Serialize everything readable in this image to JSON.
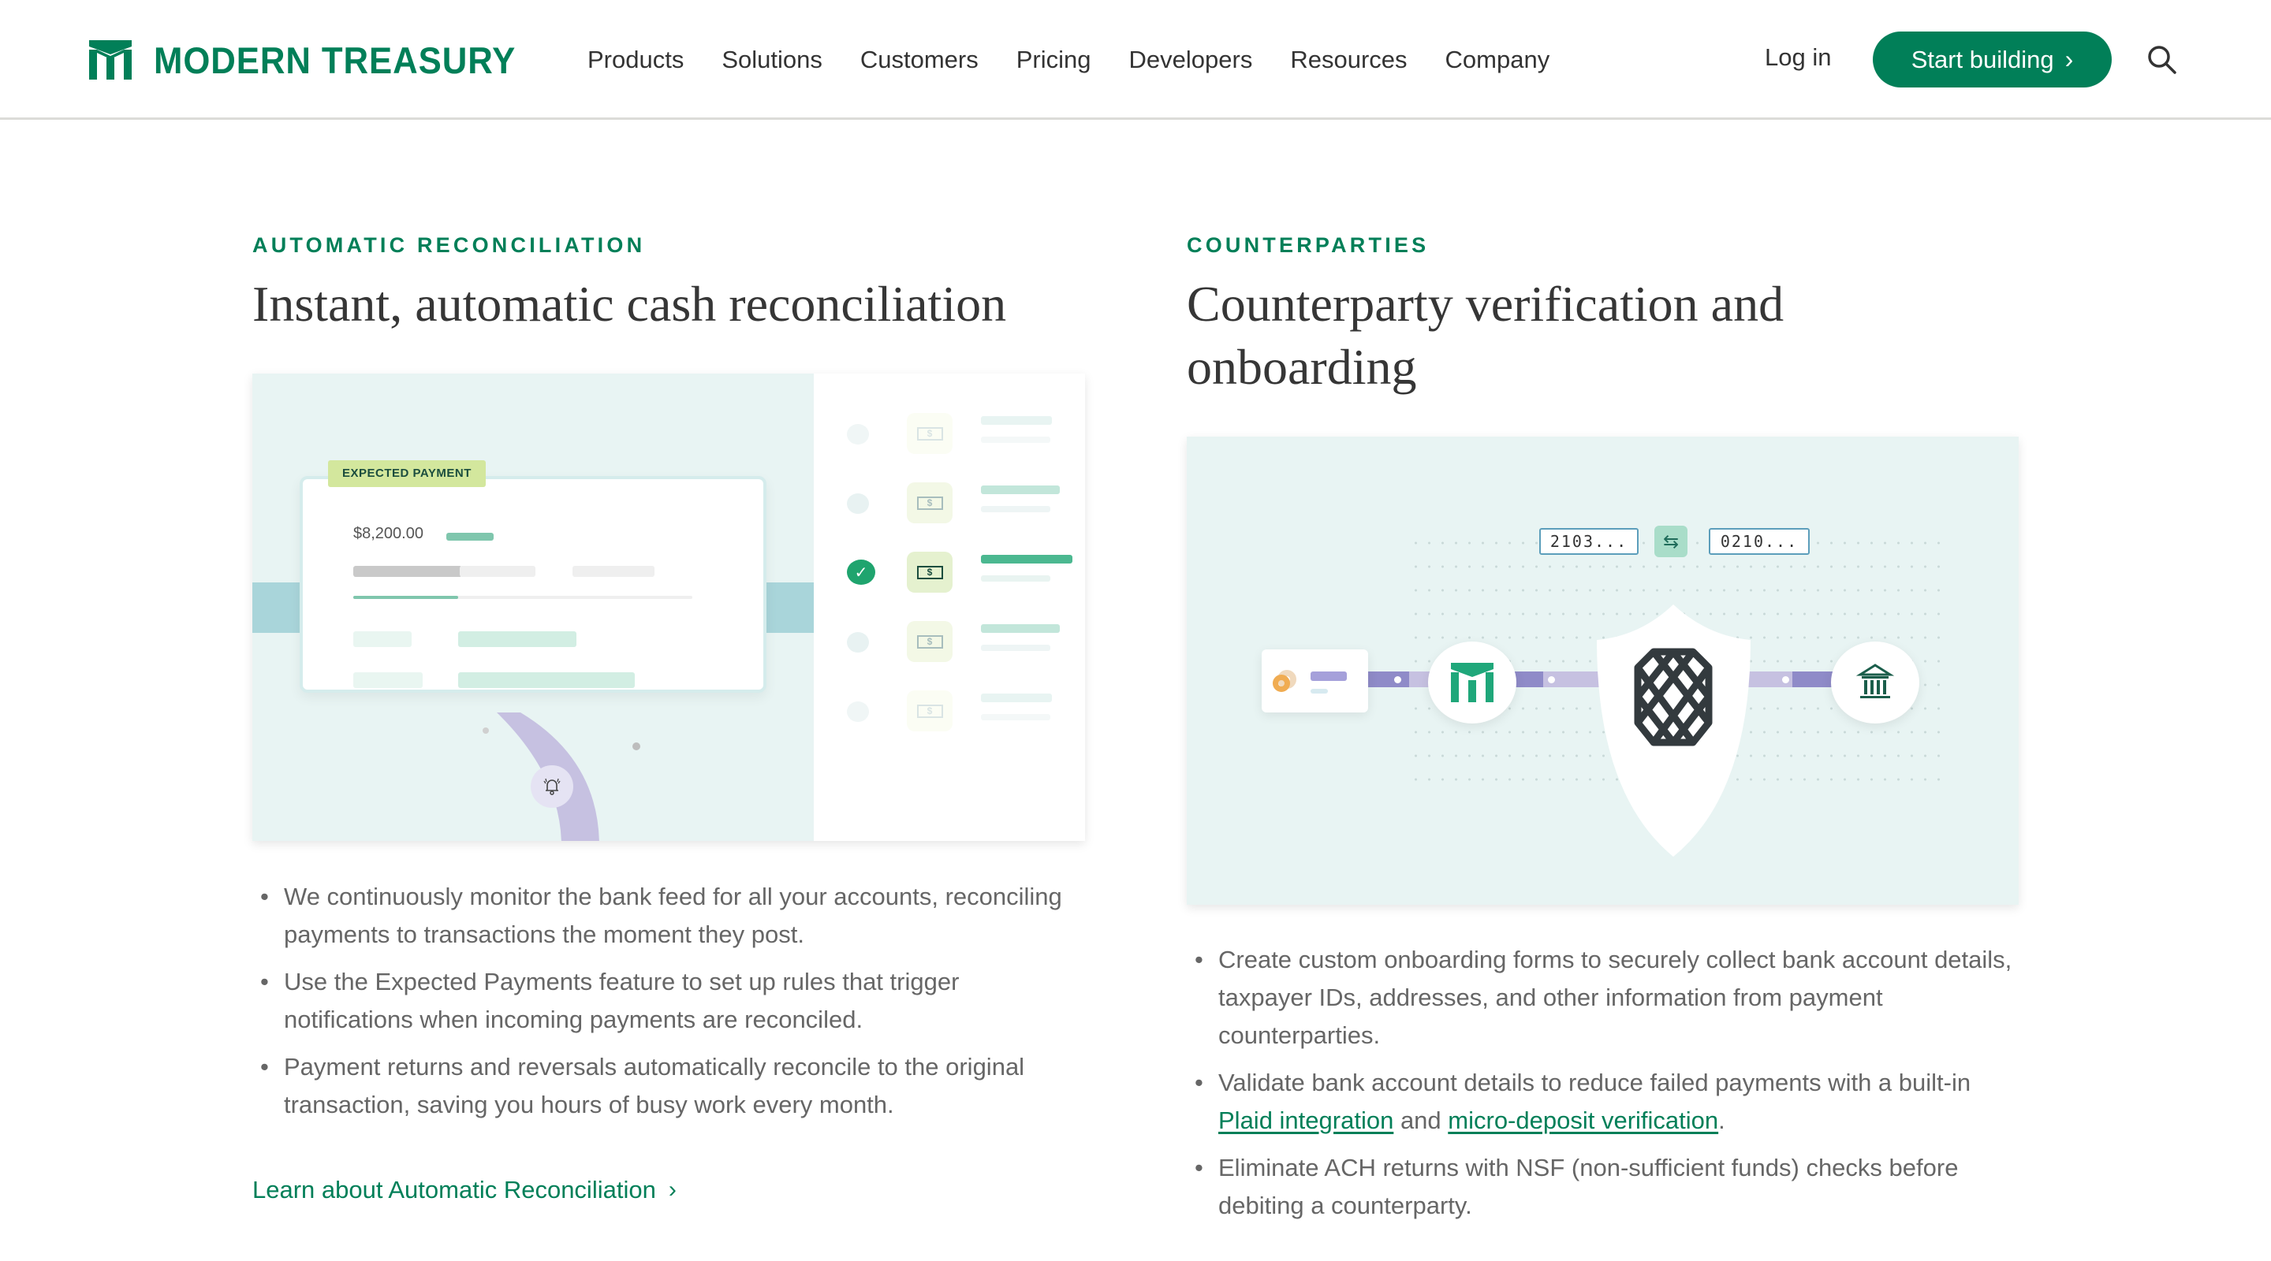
{
  "nav": {
    "logo_text": "MODERN TREASURY",
    "links": [
      "Products",
      "Solutions",
      "Customers",
      "Pricing",
      "Developers",
      "Resources",
      "Company"
    ],
    "login": "Log in",
    "cta": "Start building",
    "cta_icon": "chevron-right-icon",
    "search_icon": "search-icon"
  },
  "colors": {
    "brand": "#017f58",
    "text": "#363636",
    "body_text": "#666666",
    "illustration_bg": "#e8f4f3",
    "accent_purple": "#8f8bc8",
    "tag_green": "#d3e79d"
  },
  "left": {
    "eyebrow": "AUTOMATIC RECONCILIATION",
    "heading": "Instant, automatic cash reconciliation",
    "illustration": {
      "tag": "EXPECTED PAYMENT",
      "amount": "$8,200.00",
      "progress": 0.31,
      "bell_icon": "bell-icon",
      "rows": [
        {
          "state": "faded",
          "symbol": "$"
        },
        {
          "state": "pending",
          "symbol": "$"
        },
        {
          "state": "matched",
          "symbol": "$"
        },
        {
          "state": "pending",
          "symbol": "$"
        },
        {
          "state": "faded",
          "symbol": "$"
        }
      ]
    },
    "bullets": [
      "We continuously monitor the bank feed for all your accounts, reconciling payments to transactions the moment they post.",
      "Use the Expected Payments feature to set up rules that trigger notifications when incoming payments are reconciled.",
      "Payment returns and reversals automatically reconcile to the original transaction, saving you hours of busy work every month."
    ],
    "learn_link": "Learn about Automatic Reconciliation"
  },
  "right": {
    "eyebrow": "COUNTERPARTIES",
    "heading": "Counterparty verification and onboarding",
    "illustration": {
      "code_left": "2103...",
      "code_right": "0210...",
      "swap_icon": "swap-arrows-icon",
      "nodes": [
        "counterparty-card",
        "modern-treasury-logo",
        "plaid-shield",
        "bank-icon"
      ]
    },
    "bullets": {
      "b1": "Create custom onboarding forms to securely collect bank account details, taxpayer IDs, addresses, and other information from payment counterparties.",
      "b2_pre": "Validate bank account details to reduce failed payments with a built-in ",
      "b2_link1": "Plaid integration",
      "b2_mid": " and ",
      "b2_link2": "micro-deposit verification",
      "b2_post": ".",
      "b3": "Eliminate ACH returns with NSF (non-sufficient funds) checks before debiting a counterparty."
    }
  }
}
